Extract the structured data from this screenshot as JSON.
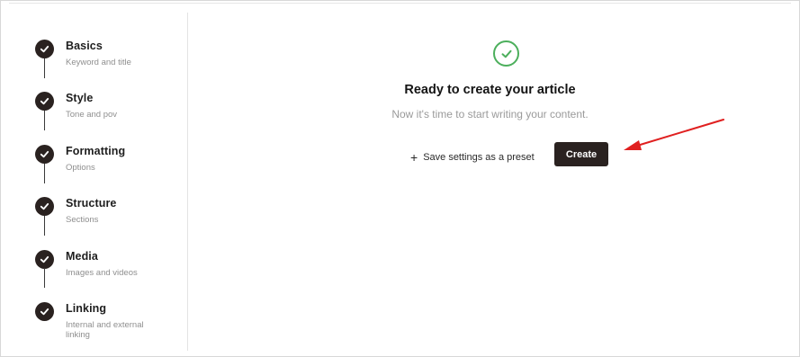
{
  "steps": [
    {
      "title": "Basics",
      "subtitle": "Keyword and title",
      "icon": "check-icon"
    },
    {
      "title": "Style",
      "subtitle": "Tone and pov",
      "icon": "check-icon"
    },
    {
      "title": "Formatting",
      "subtitle": "Options",
      "icon": "check-icon"
    },
    {
      "title": "Structure",
      "subtitle": "Sections",
      "icon": "check-icon"
    },
    {
      "title": "Media",
      "subtitle": "Images and videos",
      "icon": "check-icon"
    },
    {
      "title": "Linking",
      "subtitle": "Internal and external linking",
      "icon": "check-icon"
    }
  ],
  "main": {
    "status_icon": "check-circle-icon",
    "title": "Ready to create your article",
    "subtitle": "Now it's time to start writing your content.",
    "preset_label": "Save settings as a preset",
    "preset_icon": "plus-icon",
    "create_label": "Create"
  },
  "colors": {
    "step_icon_bg": "#2a2220",
    "success": "#4caf5c",
    "create_bg": "#2a2220",
    "annotation_arrow": "#e02020"
  }
}
